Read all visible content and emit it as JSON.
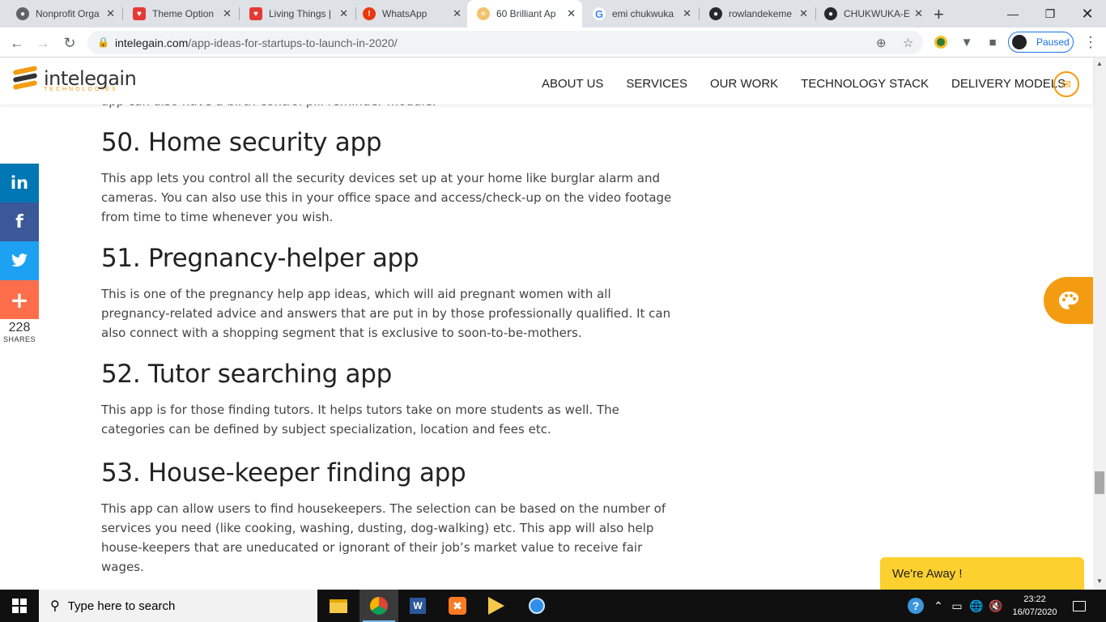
{
  "browser": {
    "tabs": [
      {
        "title": "Nonprofit Orga",
        "favicon": "globe-icon",
        "active": false
      },
      {
        "title": "Theme Option",
        "favicon": "livingthings-icon",
        "active": false
      },
      {
        "title": "Living Things |",
        "favicon": "livingthings-icon",
        "active": false
      },
      {
        "title": "WhatsApp",
        "favicon": "whatsapp-alert-icon",
        "active": false
      },
      {
        "title": "60 Brilliant Ap",
        "favicon": "intelegain-icon",
        "active": true
      },
      {
        "title": "emi chukwuka",
        "favicon": "google-icon",
        "active": false
      },
      {
        "title": "rowlandekeme",
        "favicon": "github-icon",
        "active": false
      },
      {
        "title": "CHUKWUKA-E",
        "favicon": "github-icon",
        "active": false
      }
    ],
    "url_domain": "intelegain.com",
    "url_path": "/app-ideas-for-startups-to-launch-in-2020/",
    "profile_status": "Paused"
  },
  "site": {
    "logo_name": "intelegain",
    "logo_tagline": "TECHNOLOGIES",
    "nav": [
      "ABOUT US",
      "SERVICES",
      "OUR WORK",
      "TECHNOLOGY STACK",
      "DELIVERY MODELS"
    ]
  },
  "article": {
    "cut_text": "app can also have a birth-control pill reminder module.",
    "sections": [
      {
        "heading": "50. Home security app",
        "body": "This app lets you control all the security devices set up at your home like burglar alarm and cameras. You can also use this in your office space and access/check-up on the video footage from time to time whenever you wish."
      },
      {
        "heading": "51. Pregnancy-helper app",
        "body": "This is one of the pregnancy help app ideas, which will aid pregnant women with all pregnancy-related advice and answers that are put in by those professionally qualified. It can also connect with a shopping segment that is exclusive to soon-to-be-mothers."
      },
      {
        "heading": "52. Tutor searching app",
        "body": "This app is for those finding tutors. It helps tutors take on more students as well. The categories can be defined by subject specialization, location and fees etc."
      },
      {
        "heading": "53. House-keeper finding app",
        "body": "This app can allow users to find housekeepers. The selection can be based on the number of services you need (like cooking, washing, dusting, dog-walking) etc. This app will also help house-keepers that are uneducated or ignorant of their job’s market value to receive fair wages."
      }
    ]
  },
  "social": {
    "buttons": [
      {
        "name": "linkedin",
        "glyph": "in",
        "color": "#0077b5"
      },
      {
        "name": "facebook",
        "glyph": "f",
        "color": "#3b5998"
      },
      {
        "name": "twitter",
        "glyph": "t",
        "color": "#1da1f2"
      },
      {
        "name": "more",
        "glyph": "+",
        "color": "#ff6e4a"
      }
    ],
    "share_count": "228",
    "share_label": "SHARES"
  },
  "chat": {
    "label": "We're Away !"
  },
  "taskbar": {
    "search_placeholder": "Type here to search",
    "time": "23:22",
    "date": "16/07/2020"
  },
  "colors": {
    "brand_orange": "#f39c12",
    "chat_yellow": "#fcd02e"
  }
}
